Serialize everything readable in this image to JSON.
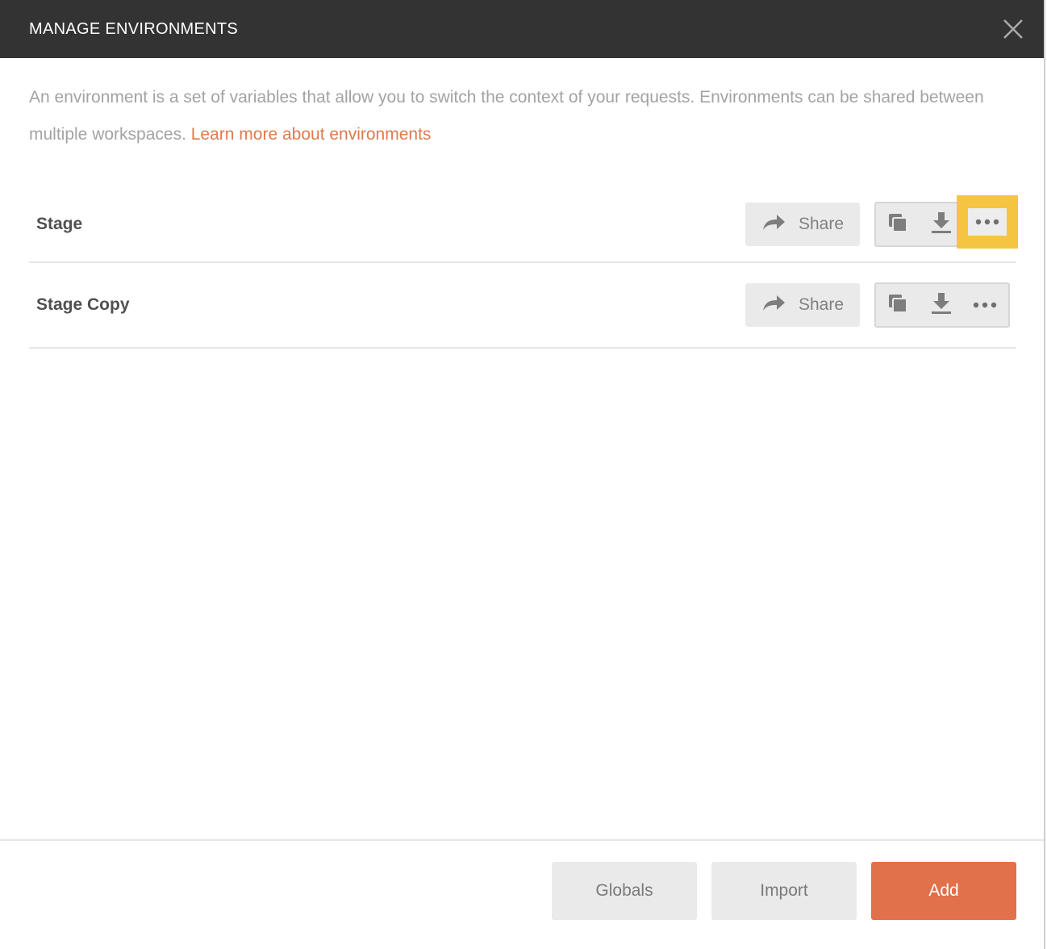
{
  "header": {
    "title": "MANAGE ENVIRONMENTS",
    "close_icon": "close-icon"
  },
  "description": {
    "text": "An environment is a set of variables that allow you to switch the context of your requests. Environments can be shared between multiple workspaces. ",
    "link_text": "Learn more about environments"
  },
  "environments": [
    {
      "name": "Stage",
      "share_label": "Share",
      "icons": [
        "share-arrow-icon",
        "duplicate-icon",
        "download-icon",
        "more-icon"
      ],
      "more_highlighted": true
    },
    {
      "name": "Stage Copy",
      "share_label": "Share",
      "icons": [
        "share-arrow-icon",
        "duplicate-icon",
        "download-icon",
        "more-icon"
      ],
      "more_highlighted": false
    }
  ],
  "footer": {
    "globals_label": "Globals",
    "import_label": "Import",
    "add_label": "Add"
  },
  "colors": {
    "header_bg": "#333333",
    "accent": "#e0714a",
    "link": "#e07a4c",
    "highlight": "#f5c542"
  }
}
